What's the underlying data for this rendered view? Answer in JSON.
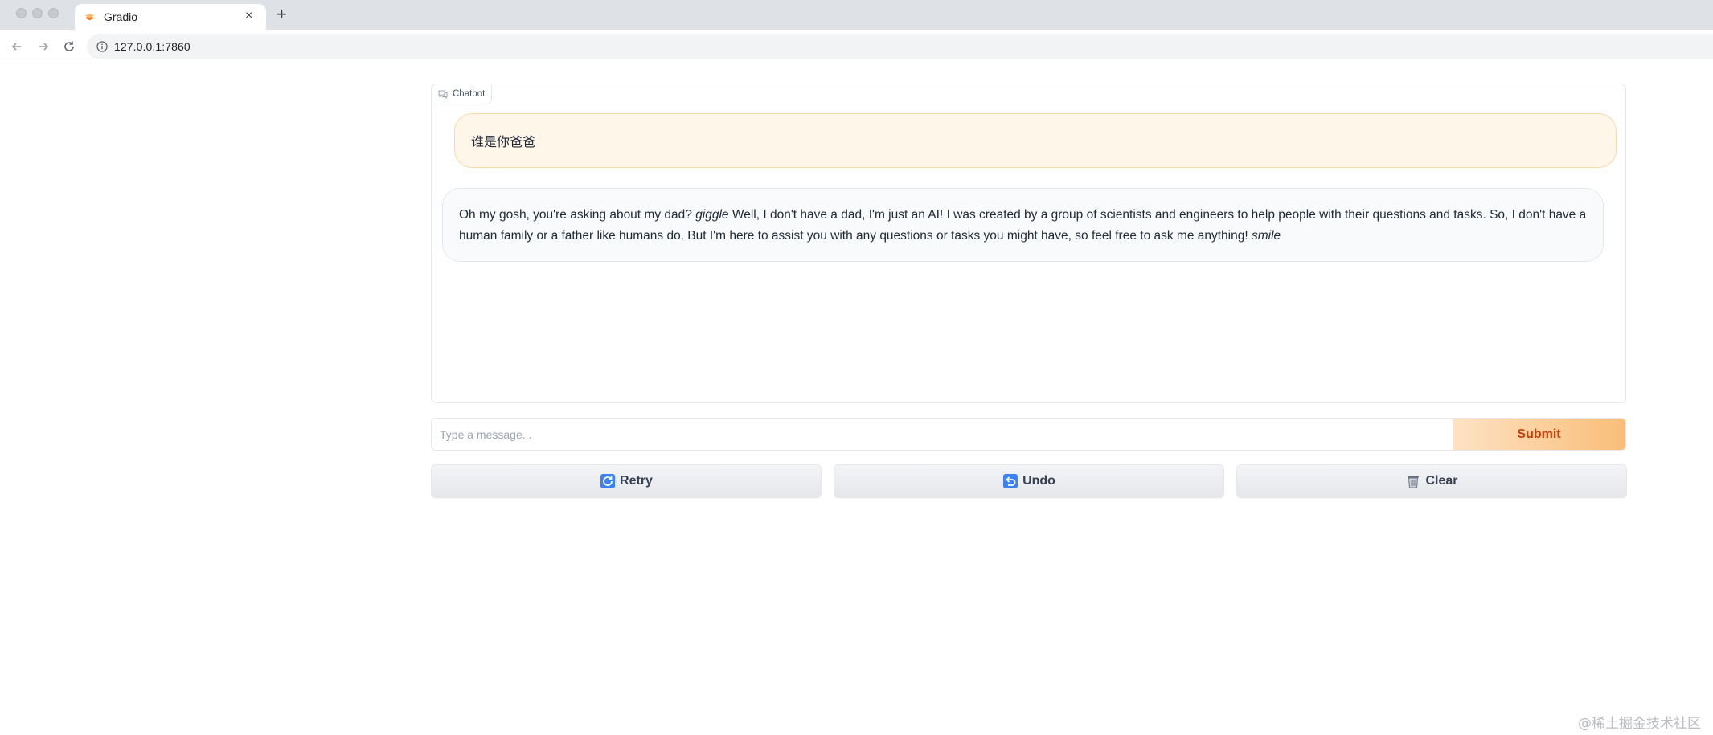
{
  "browser": {
    "tab_title": "Gradio",
    "url": "127.0.0.1:7860"
  },
  "chatbot": {
    "label": "Chatbot",
    "messages": [
      {
        "role": "user",
        "text": "谁是你爸爸"
      },
      {
        "role": "bot",
        "part1": "Oh my gosh, you're asking about my dad? ",
        "em1": "giggle",
        "part2": " Well, I don't have a dad, I'm just an AI! I was created by a group of scientists and engineers to help people with their questions and tasks. So, I don't have a human family or a father like humans do. But I'm here to assist you with any questions or tasks you might have, so feel free to ask me anything! ",
        "em2": "smile"
      }
    ]
  },
  "input": {
    "placeholder": "Type a message...",
    "value": "",
    "submit_label": "Submit"
  },
  "actions": {
    "retry_label": "Retry",
    "undo_label": "Undo",
    "clear_label": "Clear"
  },
  "watermark": "@稀土掘金技术社区",
  "colors": {
    "accent": "#f97316",
    "user_bubble": "#fff6ea",
    "bot_bubble": "#f9fafb"
  },
  "icons": {
    "retry": "retry-icon",
    "undo": "undo-icon",
    "clear": "trash-icon"
  }
}
